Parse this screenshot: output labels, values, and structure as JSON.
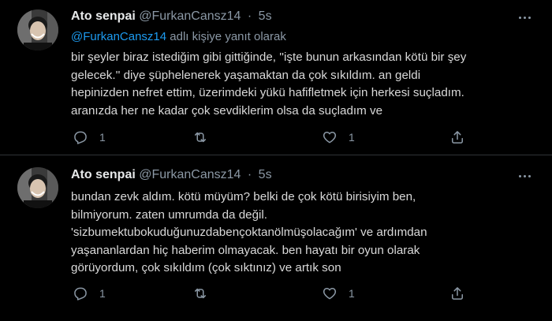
{
  "tweets": [
    {
      "name": "Ato senpai",
      "handle": "@FurkanCansz14",
      "separator": "·",
      "time": "5s",
      "replying_mention": "@FurkanCansz14",
      "replying_suffix": " adlı kişiye yanıt olarak",
      "body": "bir şeyler biraz istediğim gibi gittiğinde, ''işte bunun arkasından kötü bir şey\ngelecek.'' diye şüphelenerek yaşamaktan da çok sıkıldım. an geldi\nhepinizden nefret ettim, üzerimdeki yükü hafifletmek için herkesi suçladım.\naranızda her ne kadar çok sevdiklerim olsa da suçladım ve",
      "reply_count": "1",
      "retweet_count": "",
      "like_count": "1",
      "icons": {
        "reply": "reply-icon",
        "retweet": "retweet-icon",
        "like": "heart-icon",
        "share": "share-icon",
        "more": "more-icon"
      }
    },
    {
      "name": "Ato senpai",
      "handle": "@FurkanCansz14",
      "separator": "·",
      "time": "5s",
      "body": "bundan zevk aldım. kötü müyüm? belki de çok kötü birisiyim ben,\nbilmiyorum. zaten umrumda da değil.\n'sizbumektubokuduğunuzdabençoktanölmüşolacağım' ve ardımdan\nyaşananlardan hiç haberim olmayacak. ben hayatı bir oyun olarak\ngörüyordum, çok sıkıldım (çok sıktınız) ve artık son",
      "reply_count": "1",
      "retweet_count": "",
      "like_count": "1",
      "icons": {
        "reply": "reply-icon",
        "retweet": "retweet-icon",
        "like": "heart-icon",
        "share": "share-icon",
        "more": "more-icon"
      }
    }
  ],
  "colors": {
    "background": "#000000",
    "text": "#d9d9d9",
    "secondary": "#8b98a5",
    "link": "#1d9bf0"
  }
}
